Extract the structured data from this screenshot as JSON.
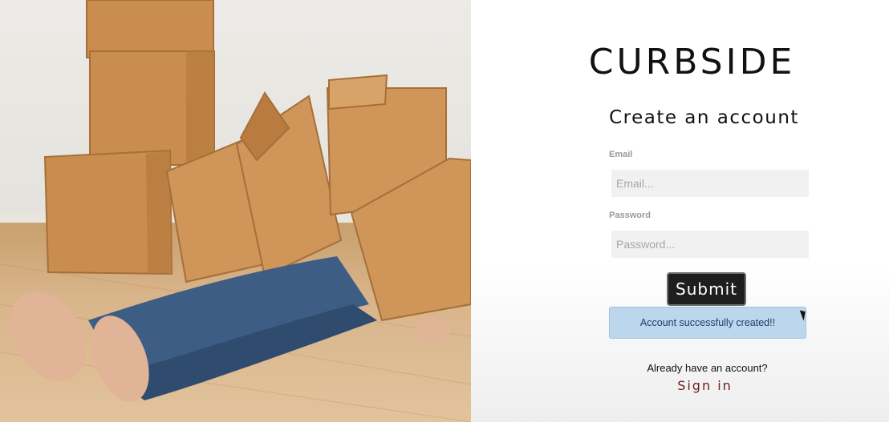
{
  "brand": {
    "logo_text": "CURBSIDE"
  },
  "form": {
    "title": "Create an account",
    "email_label": "Email",
    "email_placeholder": "Email...",
    "password_label": "Password",
    "password_placeholder": "Password...",
    "submit_label": "Submit",
    "success_message": "Account successfully created!!"
  },
  "footer": {
    "prompt": "Already have an account?",
    "signin_link": "Sign in"
  },
  "colors": {
    "submit_bg": "#1e1e1e",
    "alert_bg": "#bcd6ee",
    "alert_text": "#1d3c6a",
    "signin_link": "#6b1c1c"
  }
}
